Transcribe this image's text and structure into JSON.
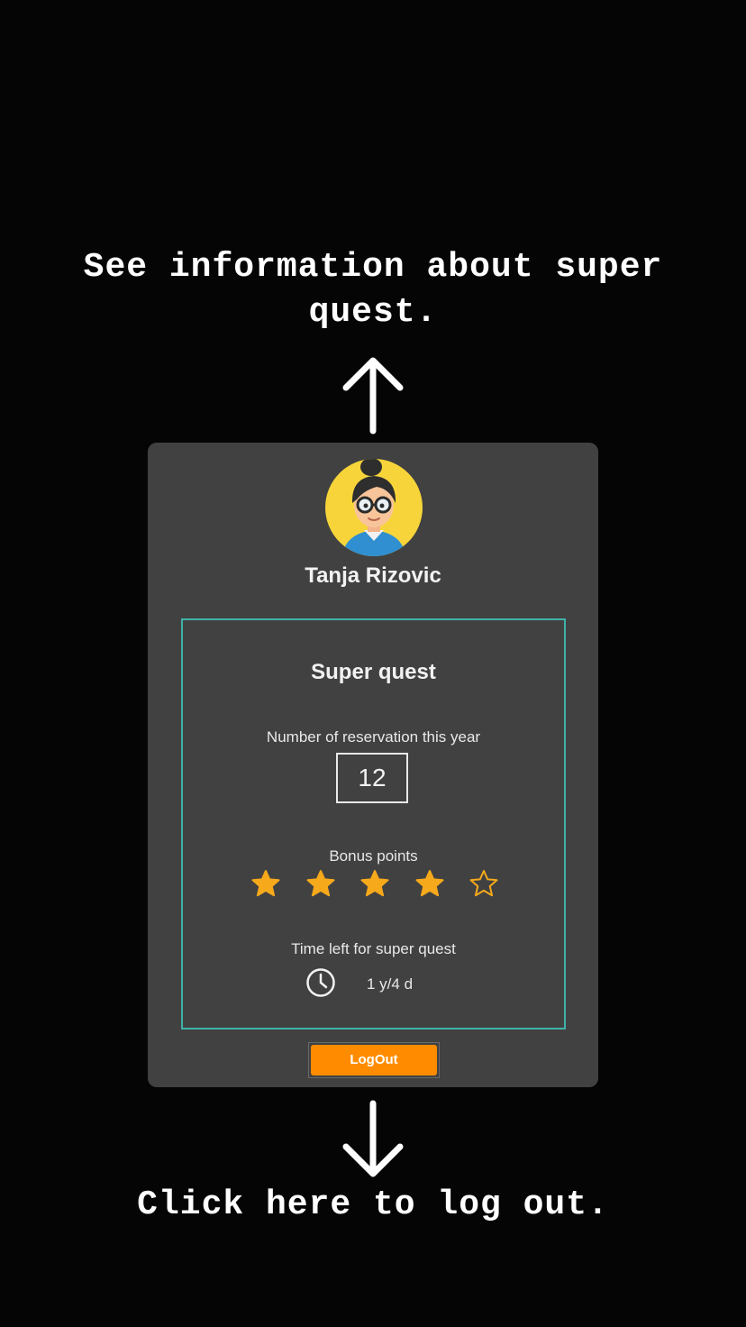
{
  "annotations": {
    "top_caption": "See information about super quest.",
    "bottom_caption": "Click here to log out."
  },
  "profile": {
    "name": "Tanja Rizovic",
    "avatar_icon": "woman-with-glasses-avatar-icon"
  },
  "super_quest": {
    "title": "Super quest",
    "reservations_label": "Number of reservation this year",
    "reservations_value": "12",
    "bonus_label": "Bonus points",
    "bonus_stars": {
      "filled": 4,
      "total": 5
    },
    "time_label": "Time left for super quest",
    "time_icon": "clock-icon",
    "time_value": "1 y/4 d"
  },
  "actions": {
    "logout_label": "LogOut"
  },
  "colors": {
    "background": "#050505",
    "card": "#414141",
    "accent_border": "#3fb2a8",
    "star": "#f6a91b",
    "logout": "#ff8c00"
  }
}
